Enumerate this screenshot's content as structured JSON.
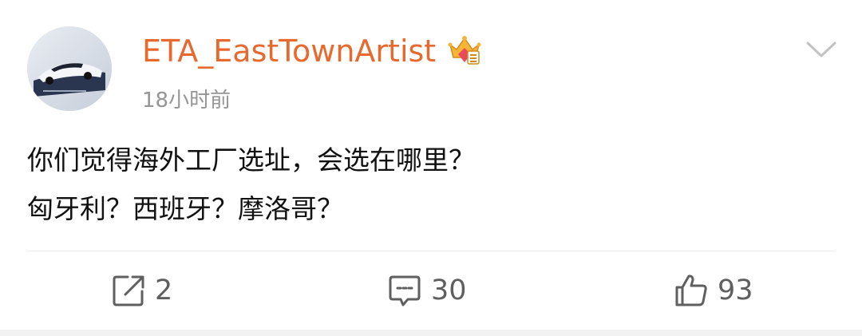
{
  "post": {
    "username": "ETA_EastTownArtist",
    "timestamp": "18小时前",
    "content_lines": [
      "你们觉得海外工厂选址，会选在哪里？",
      "匈牙利？西班牙？摩洛哥？"
    ]
  },
  "actions": {
    "repost_count": "2",
    "comment_count": "30",
    "like_count": "93"
  },
  "icons": {
    "badge": "crown-badge-icon",
    "more": "chevron-down-icon",
    "repost": "repost-icon",
    "comment": "comment-icon",
    "like": "thumbs-up-icon"
  },
  "colors": {
    "username": "#e8692e",
    "timestamp": "#959595",
    "text": "#111111",
    "icon": "#5f5f5f",
    "divider": "#ebebeb"
  }
}
